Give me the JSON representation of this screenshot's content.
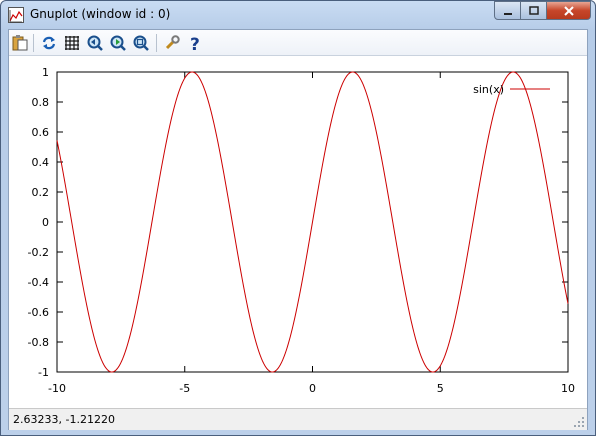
{
  "window": {
    "title": "Gnuplot (window id : 0)",
    "controls": {
      "minimize": "minimize",
      "maximize": "maximize",
      "close": "close"
    }
  },
  "toolbar": {
    "items": [
      {
        "icon": "copy-to-clipboard-icon"
      },
      {
        "icon": "replot-icon"
      },
      {
        "icon": "grid-icon"
      },
      {
        "icon": "zoom-previous-icon"
      },
      {
        "icon": "zoom-next-icon"
      },
      {
        "icon": "unzoom-icon"
      },
      {
        "icon": "options-wrench-icon"
      },
      {
        "icon": "help-icon"
      }
    ]
  },
  "colors": {
    "series": "#cc0000",
    "axes": "#000000",
    "background": "#ffffff"
  },
  "status": {
    "coords": "2.63233, -1.21220"
  },
  "chart_data": {
    "type": "line",
    "function": "sin(x)",
    "series": [
      {
        "name": "sin(x)",
        "function": "sin"
      }
    ],
    "xlim": [
      -10,
      10
    ],
    "ylim": [
      -1,
      1
    ],
    "xticks": [
      "-10",
      "-5",
      "0",
      "5",
      "10"
    ],
    "yticks": [
      "-1",
      "-0.8",
      "-0.6",
      "-0.4",
      "-0.2",
      "0",
      "0.2",
      "0.4",
      "0.6",
      "0.8",
      "1"
    ],
    "legend_position": "top-right",
    "grid": false,
    "title": "",
    "xlabel": "",
    "ylabel": ""
  }
}
